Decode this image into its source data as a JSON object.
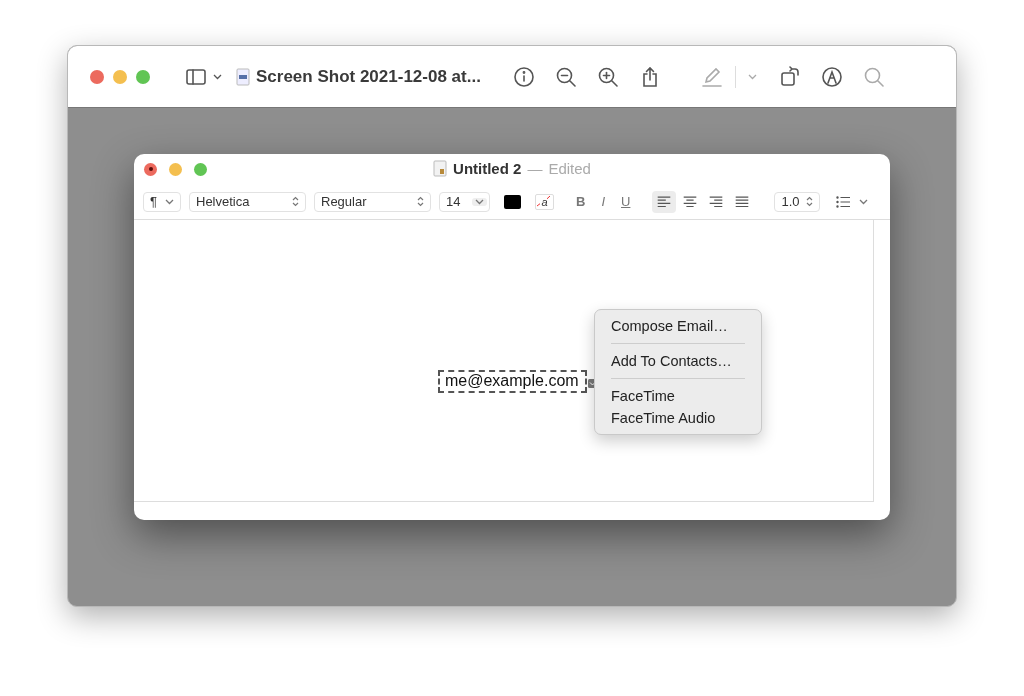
{
  "viewer": {
    "title": "Screen Shot 2021-12-08 at..."
  },
  "document": {
    "title": "Untitled 2",
    "separator": "—",
    "status": "Edited"
  },
  "format_bar": {
    "paragraph": "¶",
    "font": "Helvetica",
    "style": "Regular",
    "size": "14",
    "bold": "B",
    "italic": "I",
    "underline": "U",
    "background_glyph": "a",
    "alignments": [
      {
        "kind": "left",
        "selected": true
      },
      {
        "kind": "center",
        "selected": false
      },
      {
        "kind": "right",
        "selected": false
      },
      {
        "kind": "justify",
        "selected": false
      }
    ],
    "spacing": "1.0"
  },
  "content": {
    "email": "me@example.com"
  },
  "context_menu": {
    "groups": [
      [
        "Compose Email…"
      ],
      [
        "Add To Contacts…"
      ],
      [
        "FaceTime",
        "FaceTime Audio"
      ]
    ]
  }
}
